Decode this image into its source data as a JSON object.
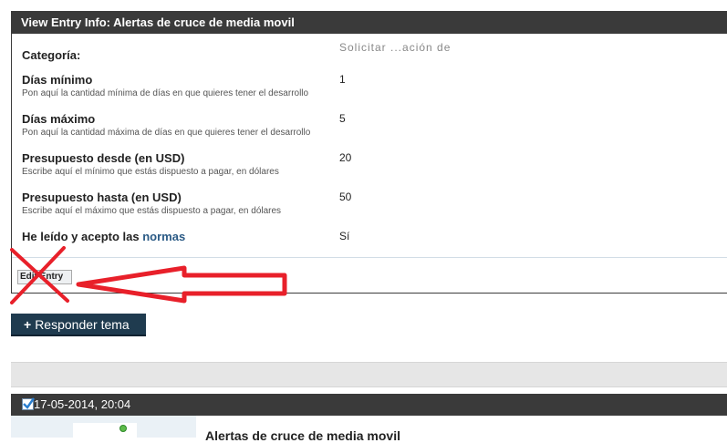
{
  "panel": {
    "title": "View Entry Info: Alertas de cruce de media movil"
  },
  "fields": [
    {
      "label": "Categoría:",
      "hint": "",
      "value": "Solicitar ...ación de"
    },
    {
      "label": "Días mínimo",
      "hint": "Pon aquí la cantidad mínima de días en que quieres tener el desarrollo",
      "value": "1"
    },
    {
      "label": "Días máximo",
      "hint": "Pon aquí la cantidad máxima de días en que quieres tener el desarrollo",
      "value": "5"
    },
    {
      "label": "Presupuesto desde (en USD)",
      "hint": "Escribe aquí el mínimo que estás dispuesto a pagar, en dólares",
      "value": "20"
    },
    {
      "label": "Presupuesto hasta (en USD)",
      "hint": "Escribe aquí el máximo que estás dispuesto a pagar, en dólares",
      "value": "50"
    }
  ],
  "terms": {
    "prefix": "He leído y acepto las ",
    "link": "normas",
    "value": "Sí"
  },
  "edit_button": {
    "label": "Edit Entry"
  },
  "reply_button": {
    "plus": "+",
    "label": "Responder tema"
  },
  "post": {
    "date": "17-05-2014, 20:04",
    "title": "Alertas de cruce de media movil"
  },
  "colors": {
    "header_bg": "#3a3a3a",
    "link": "#2a5a85",
    "annotation_red": "#e8202a",
    "reply_bg": "#1f3b4f"
  }
}
